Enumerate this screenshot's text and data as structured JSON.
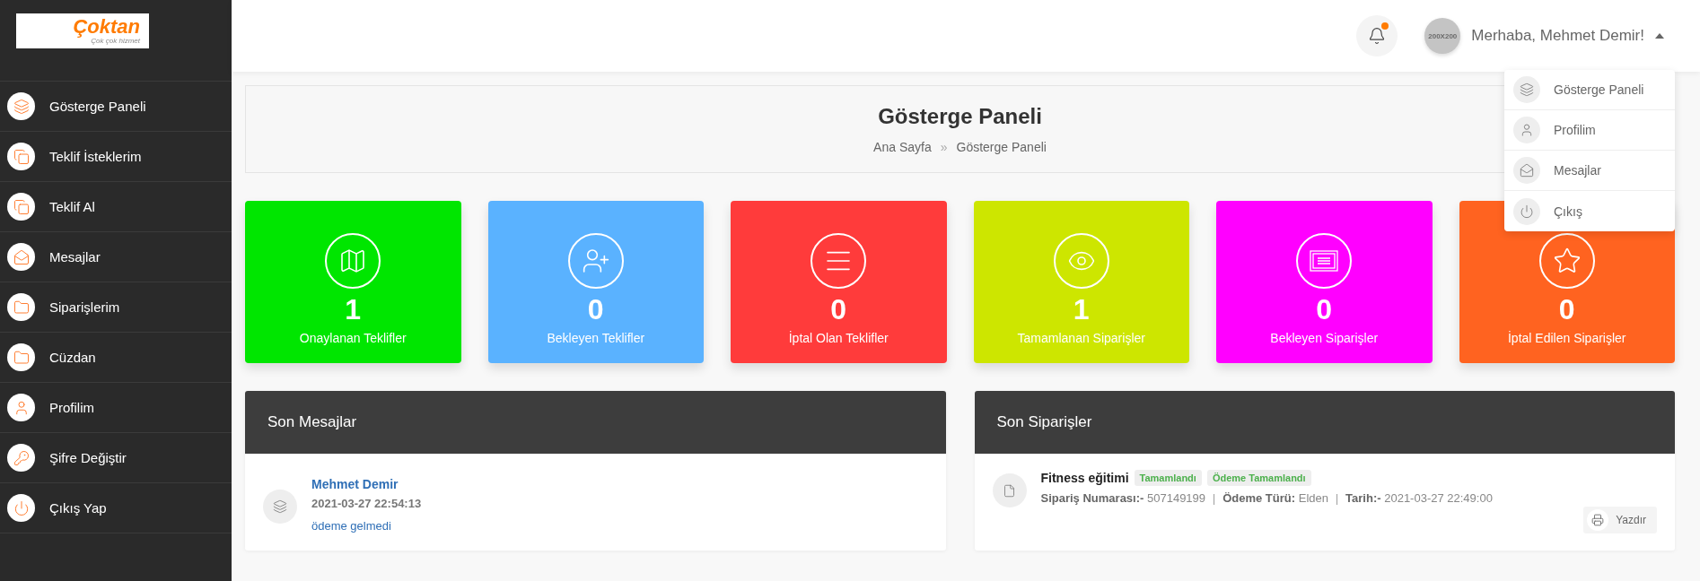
{
  "logo": {
    "name": "Çoktan",
    "tagline": "Çok çok hizmet"
  },
  "sidebar": {
    "items": [
      {
        "label": "Gösterge Paneli",
        "kind": "layers"
      },
      {
        "label": "Teklif İsteklerim",
        "kind": "files"
      },
      {
        "label": "Teklif Al",
        "kind": "files"
      },
      {
        "label": "Mesajlar",
        "kind": "mail"
      },
      {
        "label": "Siparişlerim",
        "kind": "folder"
      },
      {
        "label": "Cüzdan",
        "kind": "folder"
      },
      {
        "label": "Profilim",
        "kind": "user"
      },
      {
        "label": "Şifre Değiştir",
        "kind": "key"
      },
      {
        "label": "Çıkış Yap",
        "kind": "power"
      }
    ]
  },
  "header": {
    "notifications": {
      "unread": true
    },
    "user": {
      "avatar_text": "200X200",
      "greeting": "Merhaba, Mehmet Demir!",
      "expanded": true,
      "menu": [
        {
          "label": "Gösterge Paneli",
          "kind": "layers"
        },
        {
          "label": "Profilim",
          "kind": "user"
        },
        {
          "label": "Mesajlar",
          "kind": "mail"
        },
        {
          "label": "Çıkış",
          "kind": "power"
        }
      ]
    }
  },
  "page_title": {
    "title": "Gösterge Paneli",
    "breadcrumb": [
      {
        "label": "Ana Sayfa"
      },
      {
        "label": "Gösterge Paneli"
      }
    ],
    "separator": "»"
  },
  "stats": [
    {
      "value": "1",
      "label": "Onaylanan Teklifler",
      "color": "#00e600",
      "kind": "map"
    },
    {
      "value": "0",
      "label": "Bekleyen Teklifler",
      "color": "#5ab2ff",
      "kind": "person"
    },
    {
      "value": "0",
      "label": "İptal Olan Teklifler",
      "color": "#ff3b3b",
      "kind": "lines"
    },
    {
      "value": "1",
      "label": "Tamamlanan Siparişler",
      "color": "#cde600",
      "kind": "eye"
    },
    {
      "value": "0",
      "label": "Bekleyen Siparişler",
      "color": "#ff00ff",
      "kind": "certificate"
    },
    {
      "value": "0",
      "label": "İptal Edilen Siparişler",
      "color": "#ff6320",
      "kind": "star"
    }
  ],
  "messages": {
    "title": "Son Mesajlar",
    "items": [
      {
        "sender": "Mehmet Demir",
        "time": "2021-03-27 22:54:13",
        "text": "ödeme gelmedi"
      }
    ]
  },
  "orders": {
    "title": "Son Siparişler",
    "items": [
      {
        "name": "Fitness eğitimi",
        "tags": [
          "Tamamlandı",
          "Ödeme Tamamlandı"
        ],
        "detail_separator": "|",
        "details": [
          "**Sipariş Numarası:-** 507149199",
          "**Ödeme Türü:** Elden",
          "**Tarih:-** 2021-03-27 22:49:00"
        ],
        "print": "Yazdır"
      }
    ]
  }
}
